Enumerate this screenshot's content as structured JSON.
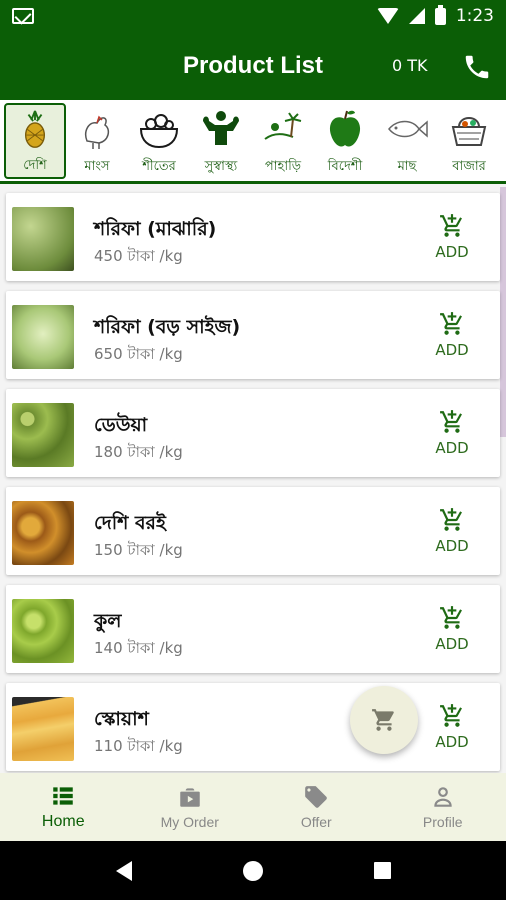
{
  "status": {
    "time": "1:23"
  },
  "app_bar": {
    "title": "Product List",
    "total": "0 TK"
  },
  "categories": [
    {
      "label": "দেশি",
      "icon": "pineapple-icon"
    },
    {
      "label": "মাংস",
      "icon": "chicken-icon"
    },
    {
      "label": "শীতের",
      "icon": "vegetable-bowl-icon"
    },
    {
      "label": "সুস্বাস্থ্য",
      "icon": "muscle-man-icon"
    },
    {
      "label": "পাহাড়ি",
      "icon": "island-icon"
    },
    {
      "label": "বিদেশী",
      "icon": "apple-icon"
    },
    {
      "label": "মাছ",
      "icon": "fish-icon"
    },
    {
      "label": "বাজার",
      "icon": "basket-icon"
    }
  ],
  "products": [
    {
      "name": "শরিফা (মাঝারি)",
      "price": "450 টাকা /kg",
      "add_label": "ADD",
      "color": "#8fa55c"
    },
    {
      "name": "শরিফা (বড় সাইজ)",
      "price": "650 টাকা /kg",
      "add_label": "ADD",
      "color": "#a9c877"
    },
    {
      "name": "ডেউয়া",
      "price": "180 টাকা /kg",
      "add_label": "ADD",
      "color": "#7c9a3e"
    },
    {
      "name": "দেশি বরই",
      "price": "150 টাকা /kg",
      "add_label": "ADD",
      "color": "#c9892a"
    },
    {
      "name": "কুল",
      "price": "140 টাকা /kg",
      "add_label": "ADD",
      "color": "#8bb43a"
    },
    {
      "name": "স্কোয়াশ",
      "price": "110 টাকা /kg",
      "add_label": "ADD",
      "color": "#e8b04a"
    }
  ],
  "bottom_nav": [
    {
      "label": "Home",
      "icon": "list-icon",
      "active": true
    },
    {
      "label": "My Order",
      "icon": "bag-icon",
      "active": false
    },
    {
      "label": "Offer",
      "icon": "tag-icon",
      "active": false
    },
    {
      "label": "Profile",
      "icon": "person-icon",
      "active": false
    }
  ],
  "colors": {
    "primary": "#0b5e06",
    "accent": "#2e6b1e",
    "nav_bg": "#f1f3e2"
  }
}
